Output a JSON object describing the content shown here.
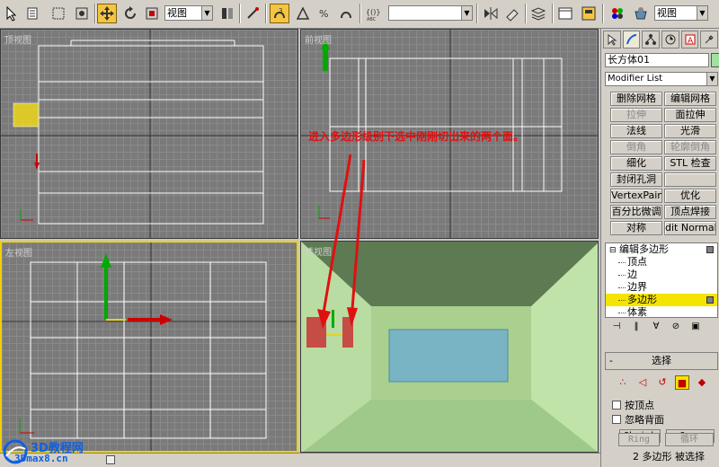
{
  "toolbar": {
    "selection_filter": "视图",
    "named_selection": "",
    "render_view": "视图",
    "colors": {
      "active": "#f5c542"
    }
  },
  "viewports": {
    "top": {
      "label": "顶视图"
    },
    "front": {
      "label": "前视图"
    },
    "left": {
      "label": "左视图"
    },
    "perspective": {
      "label": "透视图"
    }
  },
  "annotation": "进入多边形级别下选中刚刚切出来的两个面。",
  "panel": {
    "object_name": "长方体01",
    "modifier_list": "Modifier List",
    "modifier_buttons": [
      {
        "label": "删除网格",
        "enabled": true
      },
      {
        "label": "编辑网格",
        "enabled": true
      },
      {
        "label": "拉伸",
        "enabled": false
      },
      {
        "label": "面拉伸",
        "enabled": true
      },
      {
        "label": "法线",
        "enabled": true
      },
      {
        "label": "光滑",
        "enabled": true
      },
      {
        "label": "倒角",
        "enabled": false
      },
      {
        "label": "轮廓倒角",
        "enabled": false
      },
      {
        "label": "细化",
        "enabled": true
      },
      {
        "label": "STL 检查",
        "enabled": true
      },
      {
        "label": "封闭孔洞",
        "enabled": true
      },
      {
        "label": "",
        "enabled": true
      },
      {
        "label": "VertexPaint",
        "enabled": true
      },
      {
        "label": "优化",
        "enabled": true
      },
      {
        "label": "百分比微调",
        "enabled": true
      },
      {
        "label": "顶点焊接",
        "enabled": true
      },
      {
        "label": "对称",
        "enabled": true
      },
      {
        "label": "dit Normal",
        "enabled": true
      }
    ],
    "stack": {
      "root": "编辑多边形",
      "items": [
        "顶点",
        "边",
        "边界",
        "多边形",
        "体素"
      ],
      "selected": "多边形"
    },
    "selection_rollout": {
      "title": "选择",
      "by_vertex": "按顶点",
      "ignore_backfacing": "忽略背面",
      "shrink": "Shrink",
      "grow": "Grow",
      "ring": "Ring",
      "loop": "循环",
      "status": "2 多边形 被选择"
    }
  },
  "watermark": {
    "line1": "3D教程网",
    "line2": "3Dmax8.cn"
  }
}
